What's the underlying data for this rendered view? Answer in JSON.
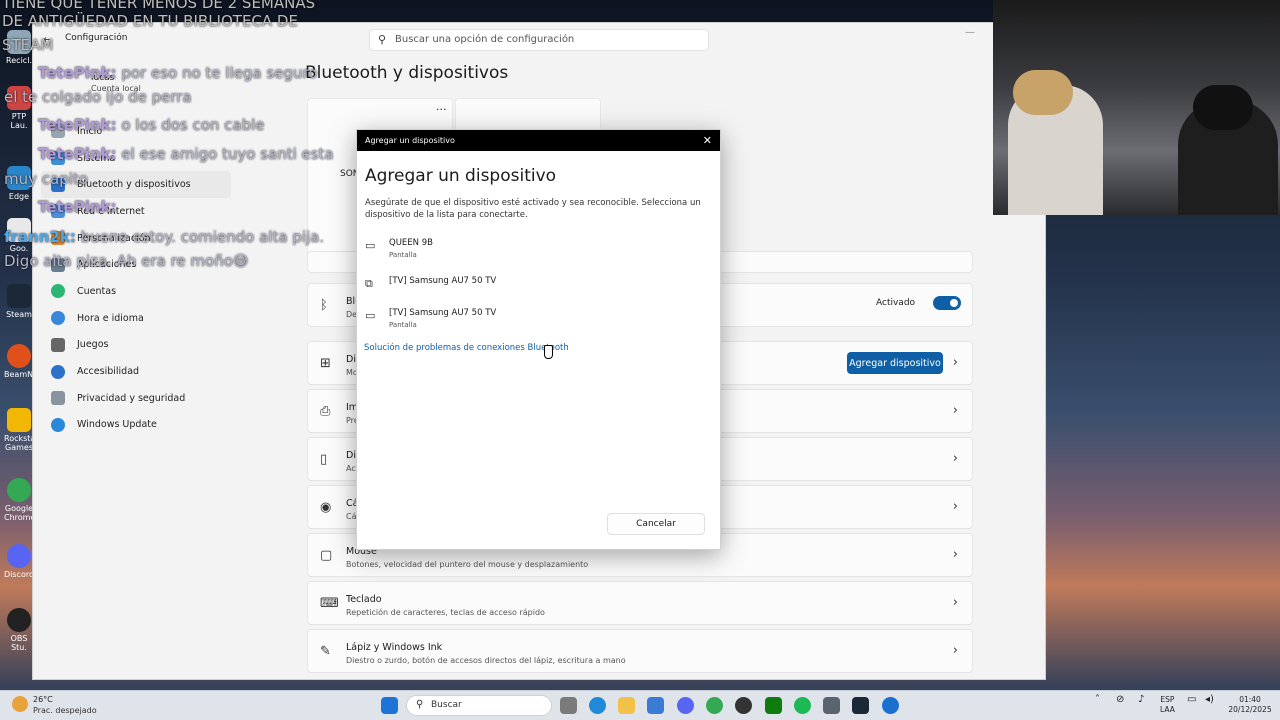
{
  "chat_overlay": {
    "top_lines": [
      "TIENE QUE TENER MENOS DE 2 SEMANAS",
      "DE ANTIGÜEDAD EN TU BIBLIOTECA DE",
      "STEAM"
    ],
    "messages": [
      {
        "user": "TetePink:",
        "text": "por eso no te llega seguro"
      },
      {
        "user": "",
        "text": "el te colgado ijo de perra"
      },
      {
        "user": "TetePink:",
        "text": "o los dos con cable"
      },
      {
        "user": "TetePink:",
        "text": "el ese amigo tuyo santi esta"
      },
      {
        "user": "",
        "text": "muy capito"
      },
      {
        "user": "TetePink:",
        "text": ""
      },
      {
        "user": "frann2k:",
        "text": "bueno estoy. comiendo alta pija."
      },
      {
        "user": "",
        "text": "Digo alta piza. Ah era re moño😅"
      }
    ]
  },
  "desktop_icons": [
    "Recicl.",
    "PTP Lau.",
    "Edge",
    "Goo.",
    "Steam",
    "BeamNG",
    "Rockstar Games",
    "Google Chrome",
    "Discord",
    "OBS Stu."
  ],
  "settings": {
    "window_title": "Configuración",
    "search_placeholder": "Buscar una opción de configuración",
    "user_name": "lucas",
    "user_type": "Cuenta local",
    "page_title": "Bluetooth y dispositivos",
    "nav": [
      {
        "label": "Inicio",
        "active": false
      },
      {
        "label": "Sistema",
        "active": false
      },
      {
        "label": "Bluetooth y dispositivos",
        "active": true
      },
      {
        "label": "Red e Internet",
        "active": false
      },
      {
        "label": "Personalización",
        "active": false
      },
      {
        "label": "Aplicaciones",
        "active": false
      },
      {
        "label": "Cuentas",
        "active": false
      },
      {
        "label": "Hora e idioma",
        "active": false
      },
      {
        "label": "Juegos",
        "active": false
      },
      {
        "label": "Accesibilidad",
        "active": false
      },
      {
        "label": "Privacidad y seguridad",
        "active": false
      },
      {
        "label": "Windows Update",
        "active": false
      }
    ],
    "device_tile_label": "SON",
    "bluetooth_row": {
      "title": "Blu",
      "sub": "Det",
      "toggle_label": "Activado"
    },
    "devices_row": {
      "title": "Dis",
      "sub": "Mo",
      "button": "Agregar dispositivo"
    },
    "printers_row": {
      "title": "Im",
      "sub": "Pre"
    },
    "phone_row": {
      "title": "Dis",
      "sub": "Acc"
    },
    "camera_row": {
      "title": "Cá",
      "sub": "Cá"
    },
    "mouse_row": {
      "title": "Mouse",
      "sub": "Botones, velocidad del puntero del mouse y desplazamiento"
    },
    "keyboard_row": {
      "title": "Teclado",
      "sub": "Repetición de caracteres, teclas de acceso rápido"
    },
    "pen_row": {
      "title": "Lápiz y Windows Ink",
      "sub": "Diestro o zurdo, botón de accesos directos del lápiz, escritura a mano"
    }
  },
  "dialog": {
    "bar_title": "Agregar un dispositivo",
    "heading": "Agregar un dispositivo",
    "description": "Asegúrate de que el dispositivo esté activado y sea reconocible. Selecciona un dispositivo de la lista para conectarte.",
    "devices": [
      {
        "name": "QUEEN 9B",
        "type": "Pantalla"
      },
      {
        "name": "[TV] Samsung AU7 50 TV",
        "type": ""
      },
      {
        "name": "[TV] Samsung AU7 50 TV",
        "type": "Pantalla"
      }
    ],
    "troubleshoot_link": "Solución de problemas de conexiones Bluetooth",
    "cancel_label": "Cancelar"
  },
  "taskbar": {
    "weather_temp": "26°C",
    "weather_desc": "Prac. despejado",
    "search_label": "Buscar",
    "lang_top": "ESP",
    "lang_bottom": "LAA",
    "time": "01:40",
    "date": "20/12/2025"
  }
}
